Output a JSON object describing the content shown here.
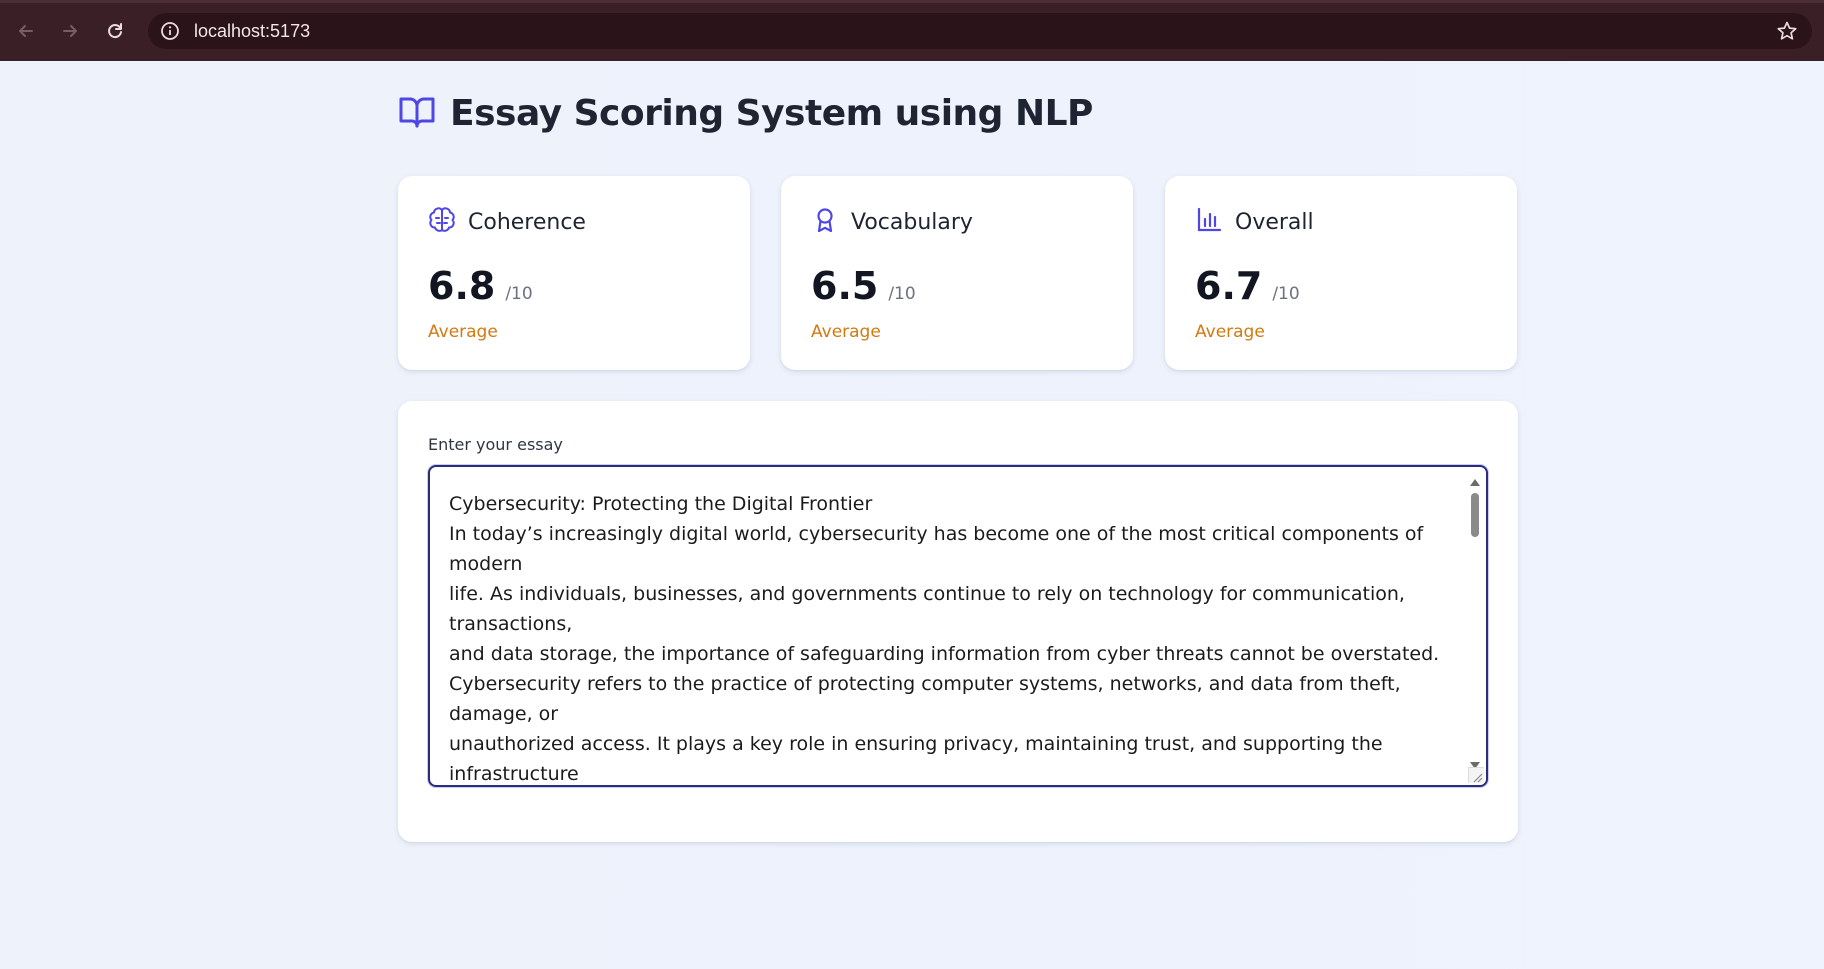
{
  "browser": {
    "url": "localhost:5173",
    "icons": [
      "back-arrow-icon",
      "forward-arrow-icon",
      "reload-icon",
      "info-icon",
      "star-icon"
    ]
  },
  "header": {
    "title": "Essay Scoring System using NLP",
    "icon": "book-open-icon"
  },
  "colors": {
    "accent": "#4f46e5",
    "score_label": "#d27a0f",
    "browser_bar": "#3a1f27"
  },
  "cards": [
    {
      "title": "Coherence",
      "icon": "brain-icon",
      "score": "6.8",
      "max": "/10",
      "label": "Average"
    },
    {
      "title": "Vocabulary",
      "icon": "award-icon",
      "score": "6.5",
      "max": "/10",
      "label": "Average"
    },
    {
      "title": "Overall",
      "icon": "bar-chart-icon",
      "score": "6.7",
      "max": "/10",
      "label": "Average"
    }
  ],
  "essay": {
    "label": "Enter your essay",
    "value": "Cybersecurity: Protecting the Digital Frontier\nIn today’s increasingly digital world, cybersecurity has become one of the most critical components of modern\nlife. As individuals, businesses, and governments continue to rely on technology for communication, transactions,\nand data storage, the importance of safeguarding information from cyber threats cannot be overstated.\nCybersecurity refers to the practice of protecting computer systems, networks, and data from theft, damage, or\nunauthorized access. It plays a key role in ensuring privacy, maintaining trust, and supporting the infrastructure\nof the digital world.\n\nThe Growing Threat Landscape\nWith the expansion of the internet and mobile technology, cyber threats have grown in number and complexity."
  }
}
